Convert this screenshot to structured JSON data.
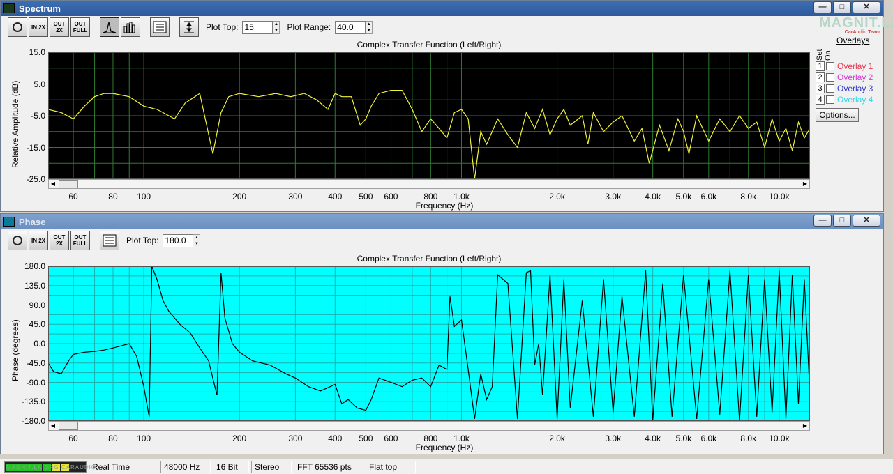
{
  "spectrum": {
    "title": "Spectrum",
    "toolbar": {
      "zoom_in_label": "IN 2X",
      "zoom_out_label": "OUT 2X",
      "zoom_full_label": "OUT FULL",
      "plot_top_label": "Plot Top:",
      "plot_top_value": "15",
      "plot_range_label": "Plot Range:",
      "plot_range_value": "40.0"
    },
    "logo": {
      "text": "MAGNIT.LA",
      "subtext": "CarAudio Team"
    },
    "plot_title": "Complex Transfer Function (Left/Right)",
    "ylabel": "Relative Amplitude (dB)",
    "xlabel": "Frequency (Hz)",
    "yticks": [
      "15.0",
      "5.0",
      "-5.0",
      "-15.0",
      "-25.0"
    ],
    "xticks": [
      "60",
      "80",
      "100",
      "200",
      "300",
      "400",
      "500",
      "600",
      "800",
      "1.0k",
      "2.0k",
      "3.0k",
      "4.0k",
      "5.0k",
      "6.0k",
      "8.0k",
      "10.0k"
    ],
    "overlays": {
      "title": "Overlays",
      "set_label": "Set",
      "on_label": "On",
      "items": [
        {
          "num": "1",
          "label": "Overlay 1",
          "color": "#e8374f"
        },
        {
          "num": "2",
          "label": "Overlay 2",
          "color": "#d23bd2"
        },
        {
          "num": "3",
          "label": "Overlay 3",
          "color": "#2f3ac8"
        },
        {
          "num": "4",
          "label": "Overlay 4",
          "color": "#30d8e8"
        }
      ],
      "options_label": "Options..."
    },
    "colors": {
      "background": "#000000",
      "grid": "#2f7a2f",
      "trace": "#f2f23a"
    }
  },
  "phase": {
    "title": "Phase",
    "toolbar": {
      "zoom_in_label": "IN 2X",
      "zoom_out_label": "OUT 2X",
      "zoom_full_label": "OUT FULL",
      "plot_top_label": "Plot Top:",
      "plot_top_value": "180.0"
    },
    "plot_title": "Complex Transfer Function (Left/Right)",
    "ylabel": "Phase (degrees)",
    "xlabel": "Frequency (Hz)",
    "yticks": [
      "180.0",
      "135.0",
      "90.0",
      "45.0",
      "0.0",
      "-45.0",
      "-90.0",
      "-135.0",
      "-180.0"
    ],
    "xticks": [
      "60",
      "80",
      "100",
      "200",
      "300",
      "400",
      "500",
      "600",
      "800",
      "1.0k",
      "2.0k",
      "3.0k",
      "4.0k",
      "5.0k",
      "6.0k",
      "8.0k",
      "10.0k"
    ],
    "colors": {
      "background": "#00ffff",
      "grid": "#1fb0b0",
      "trace": "#000000"
    }
  },
  "statusbar": {
    "meter_text": "MAGNIT.LA.ORG CARAUDIO",
    "fields": [
      "Real Time",
      "48000 Hz",
      "16 Bit",
      "Stereo",
      "FFT 65536 pts",
      "Flat top"
    ]
  },
  "chart_data": [
    {
      "type": "line",
      "title": "Complex Transfer Function (Left/Right)",
      "xlabel": "Frequency (Hz)",
      "ylabel": "Relative Amplitude (dB)",
      "xscale": "log",
      "xlim": [
        50,
        12500
      ],
      "ylim": [
        -25,
        15
      ],
      "grid": true,
      "x": [
        50,
        55,
        60,
        65,
        70,
        75,
        80,
        90,
        100,
        110,
        115,
        125,
        135,
        150,
        165,
        175,
        185,
        200,
        230,
        260,
        290,
        320,
        350,
        380,
        400,
        420,
        450,
        480,
        500,
        520,
        550,
        600,
        650,
        700,
        750,
        800,
        850,
        900,
        950,
        1000,
        1050,
        1100,
        1150,
        1200,
        1300,
        1400,
        1500,
        1600,
        1700,
        1800,
        1900,
        2000,
        2100,
        2200,
        2400,
        2500,
        2600,
        2800,
        3000,
        3200,
        3500,
        3700,
        3900,
        4200,
        4500,
        4800,
        5000,
        5200,
        5500,
        6000,
        6500,
        7000,
        7500,
        8000,
        8500,
        9000,
        9500,
        10000,
        10500,
        11000,
        11500,
        12000,
        12500
      ],
      "series": [
        {
          "values": [
            -3,
            -4,
            -6,
            -2,
            1,
            2,
            2,
            1,
            -2,
            -3,
            -4,
            -6,
            -1,
            2,
            -17,
            -4,
            1,
            2,
            1,
            2,
            1,
            2,
            0,
            -3,
            2,
            1,
            1,
            -8,
            -6,
            -2,
            2,
            3,
            3,
            -3,
            -10,
            -6,
            -9,
            -12,
            -4,
            -3,
            -6,
            -25,
            -10,
            -14,
            -6,
            -11,
            -15,
            -4,
            -9,
            -3,
            -11,
            -6,
            -3,
            -8,
            -5,
            -14,
            -4,
            -10,
            -7,
            -5,
            -13,
            -9,
            -20,
            -8,
            -16,
            -6,
            -10,
            -17,
            -5,
            -13,
            -6,
            -10,
            -5,
            -9,
            -7,
            -15,
            -6,
            -13,
            -9,
            -16,
            -7,
            -12,
            -9
          ]
        }
      ]
    },
    {
      "type": "line",
      "title": "Complex Transfer Function (Left/Right)",
      "xlabel": "Frequency (Hz)",
      "ylabel": "Phase (degrees)",
      "xscale": "log",
      "xlim": [
        50,
        12500
      ],
      "ylim": [
        -180,
        180
      ],
      "grid": true,
      "x": [
        50,
        52,
        55,
        58,
        60,
        65,
        70,
        75,
        80,
        85,
        90,
        95,
        100,
        104,
        106,
        110,
        115,
        120,
        130,
        140,
        150,
        160,
        170,
        175,
        180,
        190,
        200,
        220,
        250,
        280,
        300,
        330,
        360,
        400,
        420,
        440,
        470,
        500,
        520,
        550,
        600,
        650,
        700,
        750,
        800,
        850,
        900,
        920,
        950,
        1000,
        1050,
        1100,
        1150,
        1200,
        1250,
        1300,
        1400,
        1500,
        1600,
        1650,
        1700,
        1750,
        1800,
        1900,
        2000,
        2100,
        2200,
        2400,
        2600,
        2800,
        3000,
        3200,
        3500,
        3800,
        4000,
        4300,
        4600,
        5000,
        5500,
        6000,
        6500,
        7000,
        7500,
        8000,
        8500,
        9000,
        9500,
        10000,
        10500,
        11000,
        11500,
        12000,
        12500
      ],
      "series": [
        {
          "values": [
            -45,
            -65,
            -70,
            -40,
            -25,
            -20,
            -18,
            -15,
            -10,
            -5,
            0,
            -30,
            -100,
            -170,
            180,
            150,
            100,
            75,
            45,
            25,
            -10,
            -40,
            -120,
            165,
            60,
            0,
            -20,
            -40,
            -50,
            -70,
            -80,
            -100,
            -110,
            -95,
            -140,
            -130,
            -150,
            -155,
            -130,
            -80,
            -90,
            -100,
            -85,
            -80,
            -100,
            -50,
            -60,
            110,
            40,
            55,
            -60,
            -175,
            -70,
            -130,
            -100,
            160,
            140,
            -175,
            165,
            170,
            -50,
            0,
            -120,
            160,
            -175,
            150,
            -150,
            100,
            -170,
            150,
            -160,
            110,
            -170,
            170,
            -180,
            140,
            -170,
            160,
            -175,
            150,
            -165,
            170,
            -180,
            160,
            -170,
            150,
            -160,
            170,
            -175,
            160,
            -140,
            150,
            -120
          ]
        }
      ]
    }
  ]
}
